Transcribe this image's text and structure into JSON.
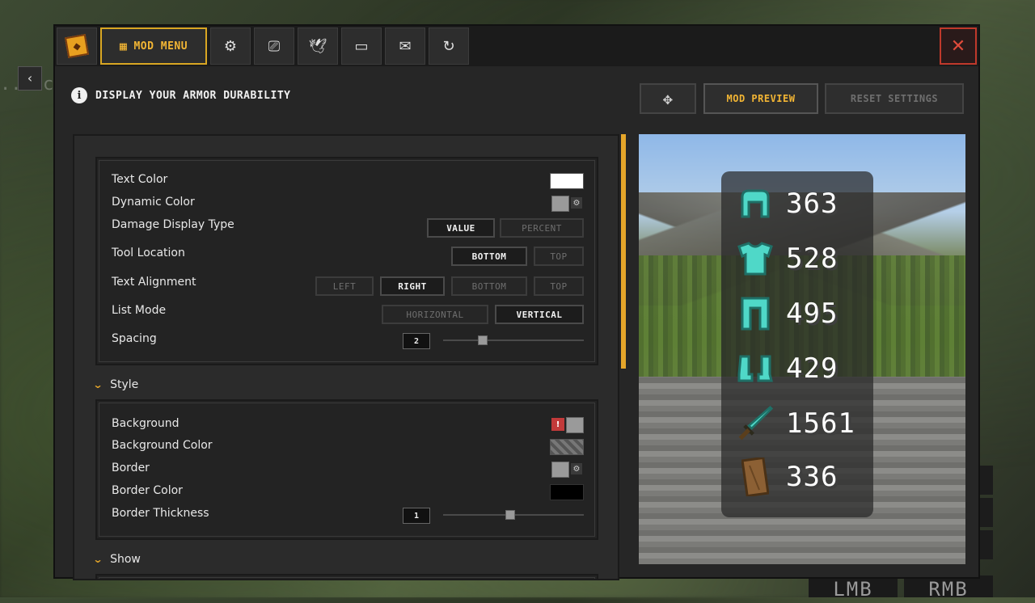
{
  "background": {
    "hint_text": "...eco",
    "lmb_label": "LMB",
    "rmb_label": "RMB"
  },
  "window": {
    "back_label": "‹",
    "tabs": [
      {
        "icon": "logo-icon",
        "label": ""
      },
      {
        "icon": "grid-icon",
        "label": "MOD MENU"
      },
      {
        "icon": "gear-icon",
        "label": ""
      },
      {
        "icon": "monitor-a-icon",
        "label": ""
      },
      {
        "icon": "bird-icon",
        "label": ""
      },
      {
        "icon": "display-icon",
        "label": ""
      },
      {
        "icon": "chat-icon",
        "label": ""
      },
      {
        "icon": "refresh-icon",
        "label": ""
      }
    ],
    "close_label": "✕"
  },
  "header": {
    "info_label": "i",
    "title": "DISPLAY YOUR ARMOR DURABILITY",
    "move_label": "✥",
    "preview_label": "MOD PREVIEW",
    "reset_label": "RESET SETTINGS"
  },
  "general": {
    "text_color_label": "Text Color",
    "text_color_value": "#ffffff",
    "dynamic_color_label": "Dynamic Color",
    "damage_display_label": "Damage Display Type",
    "damage_options": [
      "VALUE",
      "PERCENT"
    ],
    "damage_selected": "VALUE",
    "tool_location_label": "Tool Location",
    "tool_options": [
      "BOTTOM",
      "TOP"
    ],
    "tool_selected": "BOTTOM",
    "text_alignment_label": "Text Alignment",
    "align_options": [
      "LEFT",
      "RIGHT",
      "BOTTOM",
      "TOP"
    ],
    "align_selected": "RIGHT",
    "list_mode_label": "List Mode",
    "list_options": [
      "HORIZONTAL",
      "VERTICAL"
    ],
    "list_selected": "VERTICAL",
    "spacing_label": "Spacing",
    "spacing_value": "2",
    "spacing_fraction": 0.26
  },
  "style": {
    "section_label": "Style",
    "background_label": "Background",
    "background_color_label": "Background Color",
    "border_label": "Border",
    "border_color_label": "Border Color",
    "border_color_value": "#000000",
    "border_thickness_label": "Border Thickness",
    "border_thickness_value": "1",
    "border_thickness_fraction": 0.47
  },
  "show": {
    "section_label": "Show"
  },
  "preview": {
    "items": [
      {
        "icon": "diamond-helmet-icon",
        "value": "363"
      },
      {
        "icon": "diamond-chestplate-icon",
        "value": "528"
      },
      {
        "icon": "diamond-leggings-icon",
        "value": "495"
      },
      {
        "icon": "diamond-boots-icon",
        "value": "429"
      },
      {
        "icon": "diamond-sword-icon",
        "value": "1561"
      },
      {
        "icon": "shield-icon",
        "value": "336"
      }
    ]
  }
}
